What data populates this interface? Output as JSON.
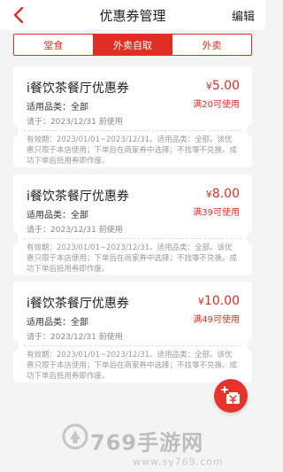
{
  "header": {
    "title": "优惠券管理",
    "edit_label": "编辑",
    "back_icon": "chevron-left-icon",
    "accent_color": "#e02e24"
  },
  "tabs": [
    {
      "label": "堂食",
      "active": false
    },
    {
      "label": "外卖自取",
      "active": true
    },
    {
      "label": "外卖",
      "active": false
    }
  ],
  "coupons": [
    {
      "name": "i餐饮茶餐厅优惠券",
      "category": "适用品类：全部",
      "deadline": "请于：2023/12/31 前使用",
      "currency": "¥",
      "amount": "5.00",
      "condition": "满20可使用",
      "description": "有效期：2023/01/01~2023/12/31。适用品类：全部。该优惠只限于本店使用；下单后在商家券中选择；不找零不兑换。成功下单后抵用券即作废。"
    },
    {
      "name": "i餐饮茶餐厅优惠券",
      "category": "适用品类：全部",
      "deadline": "请于：2023/12/31 前使用",
      "currency": "¥",
      "amount": "8.00",
      "condition": "满39可使用",
      "description": "有效期：2023/01/01~2023/12/31。适用品类：全部。该优惠只限于本店使用；下单后在商家券中选择；不找零不兑换。成功下单后抵用券即作废。"
    },
    {
      "name": "i餐饮茶餐厅优惠券",
      "category": "适用品类：全部",
      "deadline": "请于：2023/12/31 前使用",
      "currency": "¥",
      "amount": "10.00",
      "condition": "满49可使用",
      "description": "有效期：2023/01/01~2023/12/31。适用品类：全部。该优惠只限于本店使用；下单后在商家券中选择；不找零不兑换。成功下单后抵用券即作废。"
    }
  ],
  "fab": {
    "icon": "add-coupon-icon"
  },
  "watermark": {
    "text": "769手游网",
    "url": "www.sy769.com"
  }
}
